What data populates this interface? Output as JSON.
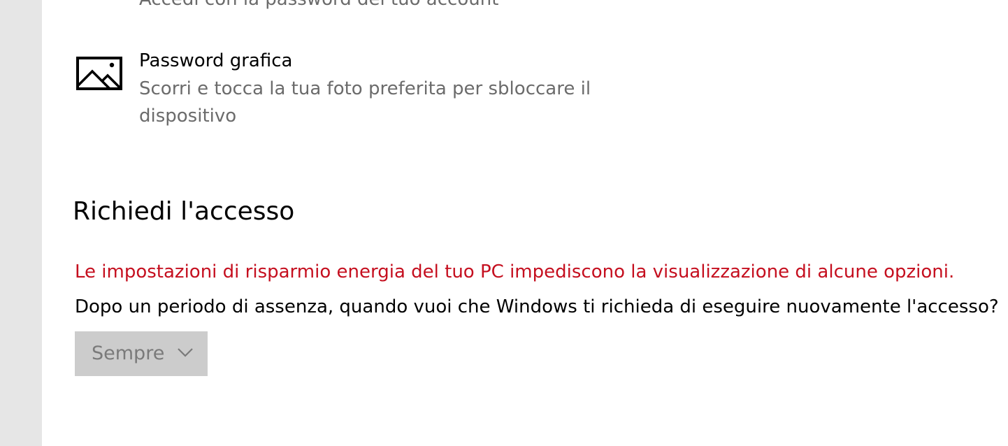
{
  "signin_options": {
    "password": {
      "description": "Accedi con la password del tuo account",
      "icon": "key-icon"
    },
    "picture_password": {
      "title": "Password grafica",
      "description": "Scorri e tocca la tua foto preferita per sbloccare il dispositivo",
      "icon": "picture-icon"
    }
  },
  "require_signin": {
    "title": "Richiedi l'accesso",
    "warning": "Le impostazioni di risparmio energia del tuo PC impediscono la visualizzazione di alcune opzioni.",
    "question": "Dopo un periodo di assenza, quando vuoi che Windows ti richieda di eseguire nuovamente l'accesso?",
    "dropdown": {
      "selected": "Sempre",
      "disabled": true,
      "icon": "chevron-down-icon"
    }
  },
  "colors": {
    "warning": "#c50f1f",
    "secondary_text": "#6b6b6b",
    "sidebar": "#e6e6e6",
    "dropdown_disabled_bg": "#cccccc",
    "dropdown_disabled_text": "#7a7a7a"
  }
}
